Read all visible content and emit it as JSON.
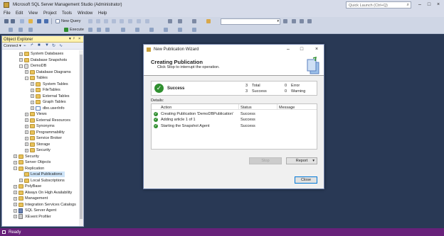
{
  "window": {
    "title": "Microsoft SQL Server Management Studio (Administrator)"
  },
  "quick_launch": {
    "placeholder": "Quick Launch (Ctrl+Q)"
  },
  "menu": [
    "File",
    "Edit",
    "View",
    "Project",
    "Tools",
    "Window",
    "Help"
  ],
  "toolbar": {
    "new_query": "New Query",
    "execute": "Execute"
  },
  "object_explorer": {
    "title": "Object Explorer",
    "connect": "Connect",
    "tree": [
      "System Databases",
      "Database Snapshots",
      "DemoDB",
      "Database Diagrams",
      "Tables",
      "System Tables",
      "FileTables",
      "External Tables",
      "Graph Tables",
      "dbo.userInfo",
      "Views",
      "External Resources",
      "Synonyms",
      "Programmability",
      "Service Broker",
      "Storage",
      "Security",
      "Security",
      "Server Objects",
      "Replication",
      "Local Publications",
      "Local Subscriptions",
      "PolyBase",
      "Always On High Availability",
      "Management",
      "Integration Services Catalogs",
      "SQL Server Agent",
      "XEvent Profiler"
    ]
  },
  "status": {
    "text": "Ready"
  },
  "dialog": {
    "title": "New Publication Wizard",
    "heading": "Creating Publication",
    "subheading": "Click Stop to interrupt the operation.",
    "summary": {
      "status": "Success",
      "total_count": "3",
      "total_label": "Total",
      "success_count": "3",
      "success_label": "Success",
      "error_count": "0",
      "error_label": "Error",
      "warning_count": "0",
      "warning_label": "Warning"
    },
    "details_label": "Details:",
    "columns": [
      "Action",
      "Status",
      "Message"
    ],
    "rows": [
      {
        "action": "Creating Publication 'DemoDBPublication'",
        "status": "Success",
        "message": ""
      },
      {
        "action": "Adding article 1 of 1",
        "status": "Success",
        "message": ""
      },
      {
        "action": "Starting the Snapshot Agent",
        "status": "Success",
        "message": ""
      }
    ],
    "buttons": {
      "stop": "Stop",
      "report": "Report",
      "close": "Close"
    }
  },
  "colors": {
    "accent": "#68217a",
    "workspace": "#293955",
    "success": "#2f8f2f"
  }
}
